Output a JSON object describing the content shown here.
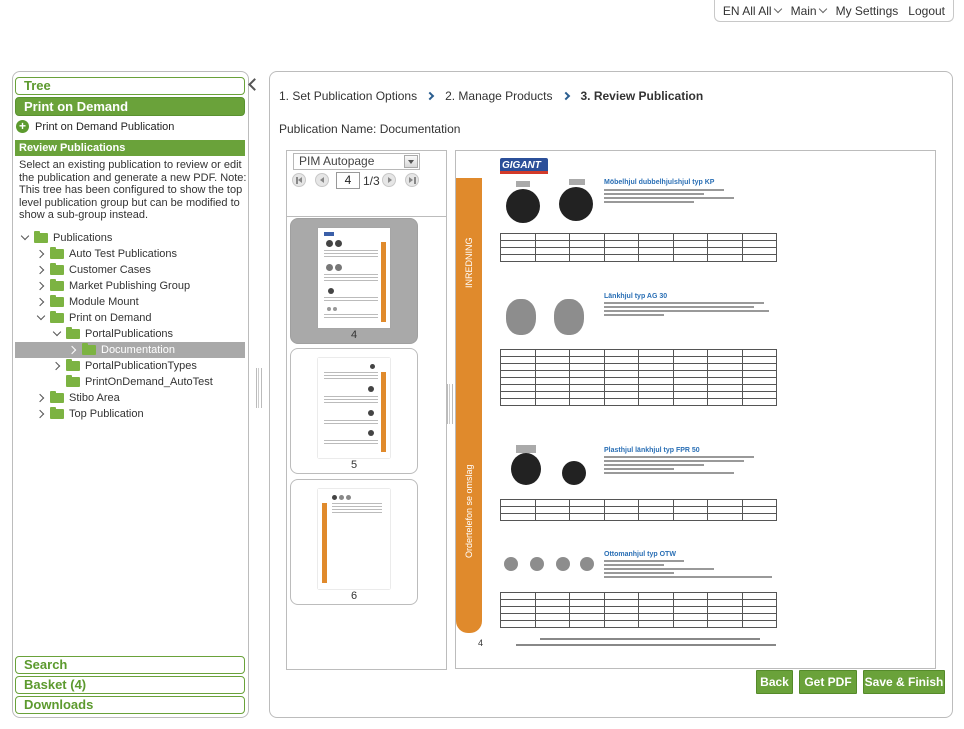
{
  "topbar": {
    "language": "EN All All",
    "main": "Main",
    "settings": "My Settings",
    "logout": "Logout"
  },
  "left": {
    "tree_header": "Tree",
    "pod_header": "Print on Demand",
    "pod_link": "Print on Demand Publication",
    "review_header": "Review Publications",
    "description": "Select an existing publication to review or edit the publication and generate a new PDF. Note: This tree has been configured to show the top level publication group but can be modified to show a sub-group instead.",
    "tree": [
      {
        "label": "Publications"
      },
      {
        "label": "Auto Test Publications"
      },
      {
        "label": "Customer Cases"
      },
      {
        "label": "Market Publishing Group"
      },
      {
        "label": "Module Mount"
      },
      {
        "label": "Print on Demand"
      },
      {
        "label": "PortalPublications"
      },
      {
        "label": "Documentation"
      },
      {
        "label": "PortalPublicationTypes"
      },
      {
        "label": "PrintOnDemand_AutoTest"
      },
      {
        "label": "Stibo Area"
      },
      {
        "label": "Top Publication"
      }
    ],
    "search_header": "Search",
    "basket_header": "Basket (4)",
    "downloads_header": "Downloads"
  },
  "main": {
    "steps": [
      "1. Set Publication Options",
      "2. Manage Products",
      "3. Review Publication"
    ],
    "publication_name": "Publication Name: Documentation",
    "template_select": "PIM Autopage",
    "current_page": "4",
    "page_total": "1/3",
    "thumbnails": [
      {
        "page": "4"
      },
      {
        "page": "5"
      },
      {
        "page": "6"
      }
    ],
    "preview": {
      "logo": "GIGANT",
      "tab_text_top": "INREDNING",
      "tab_text_bottom": "Ordertelefon se omslag",
      "products": [
        {
          "title": "Möbelhjul dubbelhjulshjul typ KP"
        },
        {
          "title": "Länkhjul typ AG 30"
        },
        {
          "title": "Plasthjul länkhjul typ FPR 50"
        },
        {
          "title": "Ottomanhjul typ OTW"
        }
      ],
      "page_number": "4"
    },
    "buttons": {
      "back": "Back",
      "get_pdf": "Get PDF",
      "save_finish": "Save & Finish"
    }
  }
}
